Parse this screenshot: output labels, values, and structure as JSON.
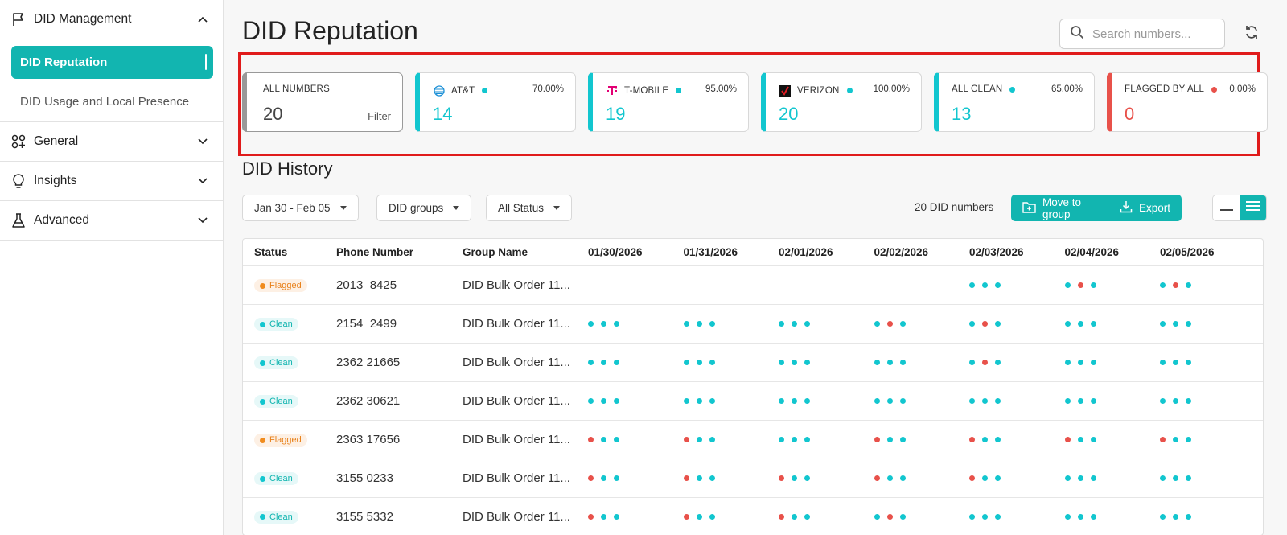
{
  "sidebar": {
    "sections": [
      {
        "label": "DID Management",
        "icon": "flag-icon",
        "expanded": true
      },
      {
        "label": "General",
        "icon": "apps-icon",
        "expanded": false
      },
      {
        "label": "Insights",
        "icon": "lightbulb-icon",
        "expanded": false
      },
      {
        "label": "Advanced",
        "icon": "flask-icon",
        "expanded": false
      }
    ],
    "sub_items": [
      {
        "label": "DID Reputation",
        "active": true
      },
      {
        "label": "DID Usage and Local Presence",
        "active": false
      }
    ]
  },
  "header": {
    "title": "DID Reputation",
    "search_placeholder": "Search numbers..."
  },
  "cards": [
    {
      "title": "ALL NUMBERS",
      "value": "20",
      "action": "Filter"
    },
    {
      "title": "AT&T",
      "value": "14",
      "percent": "70.00%"
    },
    {
      "title": "T-MOBILE",
      "value": "19",
      "percent": "95.00%"
    },
    {
      "title": "VERIZON",
      "value": "20",
      "percent": "100.00%"
    },
    {
      "title": "ALL CLEAN",
      "value": "13",
      "percent": "65.00%"
    },
    {
      "title": "FLAGGED BY ALL",
      "value": "0",
      "percent": "0.00%"
    }
  ],
  "history": {
    "title": "DID History",
    "filters": {
      "date_range": "Jan 30 - Feb 05",
      "groups": "DID groups",
      "status": "All Status"
    },
    "count_label": "20 DID numbers",
    "move_label": "Move to group",
    "export_label": "Export"
  },
  "table": {
    "columns": [
      "Status",
      "Phone Number",
      "Group Name",
      "01/30/2026",
      "01/31/2026",
      "02/01/2026",
      "02/02/2026",
      "02/03/2026",
      "02/04/2026",
      "02/05/2026"
    ],
    "rows": [
      {
        "status": "Flagged",
        "phone": "2013 ⁣ 8425",
        "group": "DID Bulk Order 11...",
        "days": [
          "",
          "",
          "",
          "",
          "ccc",
          "crc",
          "crc"
        ]
      },
      {
        "status": "Clean",
        "phone": "2154 ⁣ 2499",
        "group": "DID Bulk Order 11...",
        "days": [
          "ccc",
          "ccc",
          "ccc",
          "crc",
          "crc",
          "ccc",
          "ccc"
        ]
      },
      {
        "status": "Clean",
        "phone": "2362 ⁣21665",
        "group": "DID Bulk Order 11...",
        "days": [
          "ccc",
          "ccc",
          "ccc",
          "ccc",
          "crc",
          "ccc",
          "ccc"
        ]
      },
      {
        "status": "Clean",
        "phone": "2362 ⁣30621",
        "group": "DID Bulk Order 11...",
        "days": [
          "ccc",
          "ccc",
          "ccc",
          "ccc",
          "ccc",
          "ccc",
          "ccc"
        ]
      },
      {
        "status": "Flagged",
        "phone": "2363 ⁣17656",
        "group": "DID Bulk Order 11...",
        "days": [
          "rcc",
          "rcc",
          "ccc",
          "rcc",
          "rcc",
          "rcc",
          "rcc"
        ]
      },
      {
        "status": "Clean",
        "phone": "3155 ⁣0233",
        "group": "DID Bulk Order 11...",
        "days": [
          "rcc",
          "rcc",
          "rcc",
          "rcc",
          "rcc",
          "ccc",
          "ccc"
        ]
      },
      {
        "status": "Clean",
        "phone": "3155 ⁣5332",
        "group": "DID Bulk Order 11...",
        "days": [
          "rcc",
          "rcc",
          "rcc",
          "crc",
          "ccc",
          "ccc",
          "ccc"
        ]
      }
    ]
  },
  "colors": {
    "accent": "#12b5b0",
    "clean": "#12c6cf",
    "flagged": "#e8514a",
    "highlight": "#e01b1b"
  }
}
